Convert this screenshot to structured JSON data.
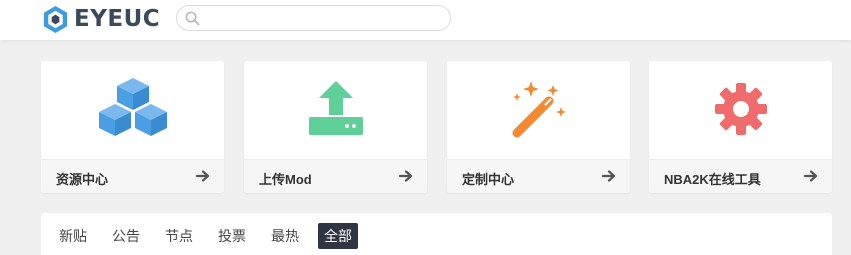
{
  "header": {
    "logo_text": "EYEUC",
    "search": {
      "value": "",
      "placeholder": ""
    }
  },
  "cards": [
    {
      "label": "资源中心",
      "icon": "cubes-icon",
      "color": "#4a9fe3"
    },
    {
      "label": "上传Mod",
      "icon": "upload-icon",
      "color": "#5fd098"
    },
    {
      "label": "定制中心",
      "icon": "magic-wand-icon",
      "color": "#f5892f"
    },
    {
      "label": "NBA2K在线工具",
      "icon": "gear-icon",
      "color": "#f06b6b"
    }
  ],
  "tabs": [
    {
      "label": "新贴",
      "active": false
    },
    {
      "label": "公告",
      "active": false
    },
    {
      "label": "节点",
      "active": false
    },
    {
      "label": "投票",
      "active": false
    },
    {
      "label": "最热",
      "active": false
    },
    {
      "label": "全部",
      "active": true
    }
  ]
}
